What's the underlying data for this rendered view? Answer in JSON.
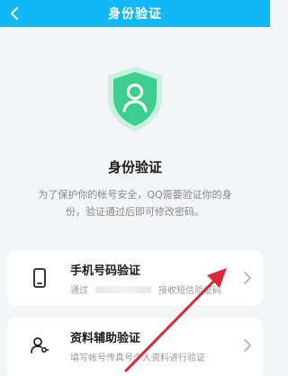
{
  "header": {
    "title": "身份验证",
    "back_icon": "back-arrow-icon",
    "color": "#12b7f5"
  },
  "hero": {
    "icon": "shield-user-icon",
    "title": "身份验证",
    "description": "为了保护你的帐号安全，QQ需要验证你的身份，验证通过后即可修改密码。"
  },
  "options": [
    {
      "title": "手机号码验证",
      "subtitle_prefix": "通过",
      "subtitle_suffix": "接收短信验证码",
      "icon": "phone-icon"
    },
    {
      "title": "资料辅助验证",
      "subtitle": "填写帐号传真号个人资料进行验证",
      "icon": "user-key-icon"
    }
  ],
  "colors": {
    "shield_green": "#3ccf8e",
    "annotation_red": "#d8283a"
  }
}
